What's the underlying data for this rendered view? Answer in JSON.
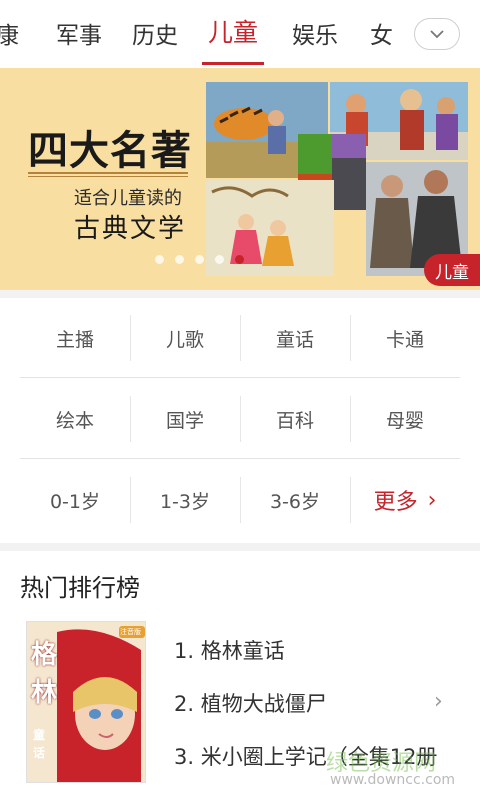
{
  "tabs": {
    "items": [
      {
        "label": "康"
      },
      {
        "label": "军事"
      },
      {
        "label": "历史"
      },
      {
        "label": "儿童",
        "active": true
      },
      {
        "label": "娱乐"
      },
      {
        "label": "女"
      }
    ],
    "more_icon": "chevron-down-icon"
  },
  "banner": {
    "title": "四大名著",
    "subtitle_1": "适合儿童读的",
    "subtitle_2": "古典文学",
    "tag": "儿童",
    "slide_count": 5,
    "active_slide": 5
  },
  "categories": {
    "rows": [
      [
        "主播",
        "儿歌",
        "童话",
        "卡通"
      ],
      [
        "绘本",
        "国学",
        "百科",
        "母婴"
      ],
      [
        "0-1岁",
        "1-3岁",
        "3-6岁",
        "更多"
      ]
    ]
  },
  "ranking": {
    "title": "热门排行榜",
    "cover_text": "格林",
    "cover_sub": "童话",
    "cover_badge": "注音版",
    "items": [
      "1. 格林童话",
      "2. 植物大战僵尸",
      "3. 米小圈上学记（全集12册"
    ]
  },
  "watermark": {
    "text": "绿色资源网",
    "url": "www.downcc.com"
  },
  "colors": {
    "accent": "#c6232b",
    "banner_bg": "#f8dea0"
  }
}
